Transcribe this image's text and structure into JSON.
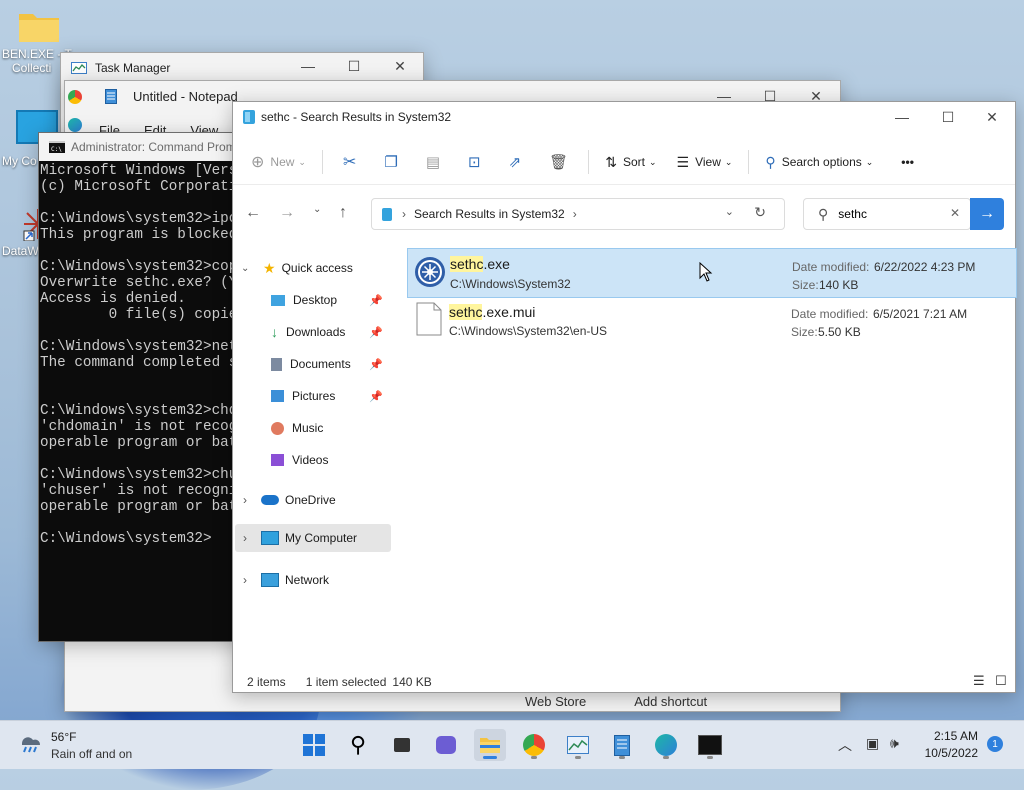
{
  "desktop": {
    "icons": [
      {
        "label_line1": "BEN.EXE - T",
        "label_line2": "Collecti"
      },
      {
        "label_line1": "My Co"
      },
      {
        "label_line1": "DataW"
      }
    ]
  },
  "task_manager": {
    "title": "Task Manager"
  },
  "notepad": {
    "title": "Untitled - Notepad",
    "menu": [
      "File",
      "Edit",
      "View"
    ]
  },
  "cmd": {
    "title": "Administrator: Command Prom",
    "lines": [
      "Microsoft Windows [Versi",
      "(c) Microsoft Corporatio",
      "",
      "C:\\Windows\\system32>ipco",
      "This program is blocked ",
      "",
      "C:\\Windows\\system32>copy",
      "Overwrite sethc.exe? (Ye",
      "Access is denied.",
      "        0 file(s) copied",
      "",
      "C:\\Windows\\system32>net ",
      "The command completed su",
      "",
      "",
      "C:\\Windows\\system32>chdo",
      "'chdomain' is not recogn",
      "operable program or batc",
      "",
      "C:\\Windows\\system32>chus",
      "'chuser' is not recogniz",
      "operable program or batc",
      "",
      "C:\\Windows\\system32>"
    ]
  },
  "explorer": {
    "title": "sethc - Search Results in System32",
    "toolbar": {
      "new_label": "New",
      "sort_label": "Sort",
      "view_label": "View",
      "search_options_label": "Search options",
      "more_label": "•••"
    },
    "address": {
      "crumb": "Search Results in System32"
    },
    "search": {
      "value": "sethc"
    },
    "sidebar": {
      "quick_access": "Quick access",
      "items": [
        {
          "label": "Desktop",
          "icon": "desktop-icon",
          "pinned": true
        },
        {
          "label": "Downloads",
          "icon": "downloads-icon",
          "pinned": true
        },
        {
          "label": "Documents",
          "icon": "documents-icon",
          "pinned": true
        },
        {
          "label": "Pictures",
          "icon": "pictures-icon",
          "pinned": true
        },
        {
          "label": "Music",
          "icon": "music-icon",
          "pinned": false
        },
        {
          "label": "Videos",
          "icon": "videos-icon",
          "pinned": false
        }
      ],
      "onedrive": "OneDrive",
      "my_computer": "My Computer",
      "network": "Network"
    },
    "files": [
      {
        "name_hl": "sethc",
        "name_rest": ".exe",
        "path": "C:\\Windows\\System32",
        "date_label": "Date modified:",
        "date": "6/22/2022 4:23 PM",
        "size_label": "Size:",
        "size": "140 KB",
        "selected": true
      },
      {
        "name_hl": "sethc",
        "name_rest": ".exe.mui",
        "path": "C:\\Windows\\System32\\en-US",
        "date_label": "Date modified:",
        "date": "6/5/2021 7:21 AM",
        "size_label": "Size:",
        "size": "5.50 KB",
        "selected": false
      }
    ],
    "status": {
      "count": "2 items",
      "selection": "1 item selected",
      "size": "140 KB"
    },
    "behind_text": {
      "left": "Web Store",
      "right": "Add shortcut"
    }
  },
  "taskbar": {
    "weather": {
      "temp": "56°F",
      "desc": "Rain off and on"
    },
    "clock": {
      "time": "2:15 AM",
      "date": "10/5/2022"
    },
    "notification_count": "1"
  },
  "colors": {
    "accent": "#2f80dd",
    "selection": "#cce4f7",
    "highlight": "#fff59d"
  }
}
